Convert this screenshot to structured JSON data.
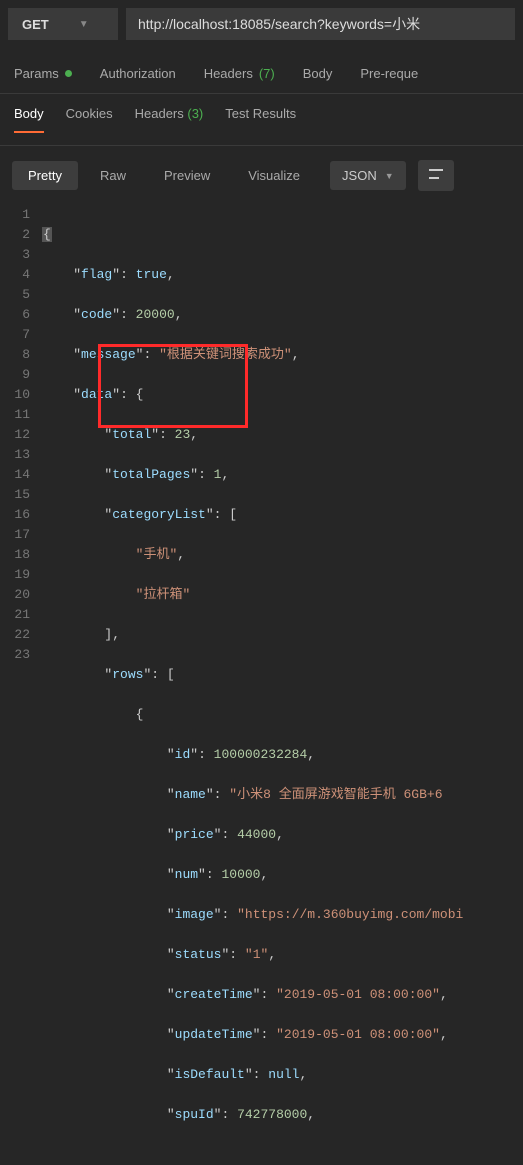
{
  "request": {
    "method": "GET",
    "url": "http://localhost:18085/search?keywords=小米"
  },
  "reqTabs": {
    "params": "Params",
    "authorization": "Authorization",
    "headers": "Headers",
    "headersCount": "(7)",
    "body": "Body",
    "prerequest": "Pre-reque"
  },
  "resTabs": {
    "body": "Body",
    "cookies": "Cookies",
    "headers": "Headers",
    "headersCount": "(3)",
    "testResults": "Test Results"
  },
  "toolbar": {
    "pretty": "Pretty",
    "raw": "Raw",
    "preview": "Preview",
    "visualize": "Visualize",
    "format": "JSON"
  },
  "json": {
    "flag_key": "flag",
    "flag_val": "true",
    "code_key": "code",
    "code_val": "20000",
    "message_key": "message",
    "message_val": "根据关键词搜索成功",
    "data_key": "data",
    "total_key": "total",
    "total_val": "23",
    "totalPages_key": "totalPages",
    "totalPages_val": "1",
    "categoryList_key": "categoryList",
    "cat1": "手机",
    "cat2": "拉杆箱",
    "rows_key": "rows",
    "id_key": "id",
    "id_val": "100000232284",
    "name_key": "name",
    "name_val": "小米8 全面屏游戏智能手机 6GB+6",
    "price_key": "price",
    "price_val": "44000",
    "num_key": "num",
    "num_val": "10000",
    "image_key": "image",
    "image_val": "https://m.360buyimg.com/mobi",
    "status_key": "status",
    "status_val": "1",
    "createTime_key": "createTime",
    "createTime_val": "2019-05-01 08:00:00",
    "updateTime_key": "updateTime",
    "updateTime_val": "2019-05-01 08:00:00",
    "isDefault_key": "isDefault",
    "isDefault_val": "null",
    "spuId_key": "spuId",
    "spuId_val": "742778000"
  }
}
